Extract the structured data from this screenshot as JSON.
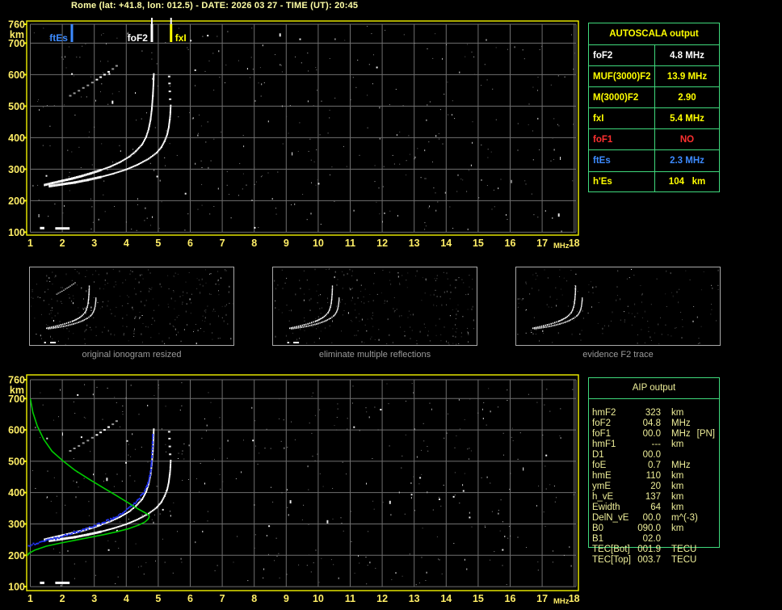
{
  "title": "Rome (lat: +41.8, lon: 012.5) - DATE: 2026 03 27 - TIME (UT): 20:45",
  "colors": {
    "background": "#000000",
    "plot_border_yellow": "#f2f200",
    "axis_label_yellow": "#ffee66",
    "grid_gray": "#6f6f6f",
    "table_green": "#3fd97c",
    "autoscala_yellow": "#ffff00",
    "autoscala_white": "#ffffff",
    "autoscala_red": "#ff3030",
    "autoscala_blue": "#3d8bff",
    "aip_text": "#eeee99",
    "profile_green": "#00cc00",
    "restored_blue": "#2233ee",
    "caption_gray": "#9b9b9b",
    "thumb_border": "#a9a9a9"
  },
  "autoscala": {
    "header": "AUTOSCALA output",
    "rows": [
      {
        "label": "foF2",
        "value": "4.8 MHz",
        "color": "#ffffff"
      },
      {
        "label": "MUF(3000)F2",
        "value": "13.9 MHz",
        "color": "#ffff00"
      },
      {
        "label": "M(3000)F2",
        "value": "2.90",
        "color": "#ffff00"
      },
      {
        "label": "fxI",
        "value": "5.4 MHz",
        "color": "#ffff00"
      },
      {
        "label": "foF1",
        "value": "NO",
        "color": "#ff3030"
      },
      {
        "label": "ftEs",
        "value": "2.3 MHz",
        "color": "#3d8bff"
      },
      {
        "label": "h'Es",
        "value": "104   km",
        "color": "#ffff00"
      }
    ]
  },
  "aip": {
    "header": "AIP output",
    "rows": [
      {
        "name": "hmF2",
        "value": "323",
        "unit": "km",
        "note": ""
      },
      {
        "name": "foF2",
        "value": "04.8",
        "unit": "MHz",
        "note": ""
      },
      {
        "name": "foF1",
        "value": "00.0",
        "unit": "MHz",
        "note": "[PN]"
      },
      {
        "name": "hmF1",
        "value": "---",
        "unit": "km",
        "note": ""
      },
      {
        "name": "D1",
        "value": "00.0",
        "unit": "",
        "note": ""
      },
      {
        "name": "foE",
        "value": "0.7",
        "unit": "MHz",
        "note": ""
      },
      {
        "name": "hmE",
        "value": "110",
        "unit": "km",
        "note": ""
      },
      {
        "name": "ymE",
        "value": "20",
        "unit": "km",
        "note": ""
      },
      {
        "name": "h_vE",
        "value": "137",
        "unit": "km",
        "note": ""
      },
      {
        "name": "Ewidth",
        "value": "64",
        "unit": "km",
        "note": ""
      },
      {
        "name": "DelN_vE",
        "value": "00.0",
        "unit": "m^(-3)",
        "note": ""
      },
      {
        "name": "B0",
        "value": "090.0",
        "unit": "km",
        "note": ""
      },
      {
        "name": "B1",
        "value": "02.0",
        "unit": "",
        "note": ""
      },
      {
        "name": "TEC[Bot]",
        "value": "001.9",
        "unit": "TECU",
        "note": ""
      },
      {
        "name": "TEC[Top]",
        "value": "003.7",
        "unit": "TECU",
        "note": ""
      }
    ]
  },
  "thumbnails": [
    {
      "caption": "original ionogram resized"
    },
    {
      "caption": "eliminate multiple reflections"
    },
    {
      "caption": "evidence F2 trace"
    }
  ],
  "chart_data": [
    {
      "type": "scatter",
      "title": "autoscaled ionogram",
      "xlabel": "MHz",
      "ylabel": "km",
      "xlim": [
        1,
        18
      ],
      "ylim": [
        100,
        760
      ],
      "x_ticks": [
        1,
        2,
        3,
        4,
        5,
        6,
        7,
        8,
        9,
        10,
        11,
        12,
        13,
        14,
        15,
        16,
        17,
        18
      ],
      "y_ticks": [
        100,
        200,
        300,
        400,
        500,
        600,
        700,
        760
      ],
      "grid": true,
      "markers": [
        {
          "label": "ftEs",
          "freq": 2.3,
          "color": "#3d8bff"
        },
        {
          "label": "foF2",
          "freq": 4.8,
          "color": "#ffffff"
        },
        {
          "label": "fxI",
          "freq": 5.4,
          "color": "#ffff00"
        }
      ],
      "series": [
        {
          "name": "o-trace",
          "color": "#ffffff",
          "style": "trace",
          "points": [
            [
              1.45,
              250
            ],
            [
              1.7,
              256
            ],
            [
              2.0,
              263
            ],
            [
              2.3,
              270
            ],
            [
              2.6,
              278
            ],
            [
              2.9,
              287
            ],
            [
              3.2,
              297
            ],
            [
              3.5,
              308
            ],
            [
              3.8,
              322
            ],
            [
              4.1,
              340
            ],
            [
              4.3,
              357
            ],
            [
              4.5,
              379
            ],
            [
              4.62,
              402
            ],
            [
              4.7,
              427
            ],
            [
              4.76,
              457
            ],
            [
              4.8,
              492
            ],
            [
              4.83,
              532
            ],
            [
              4.85,
              572
            ],
            [
              4.86,
              602
            ]
          ]
        },
        {
          "name": "x-trace",
          "color": "#ffffff",
          "style": "trace",
          "points": [
            [
              1.6,
              246
            ],
            [
              2.0,
              252
            ],
            [
              2.4,
              258
            ],
            [
              2.8,
              266
            ],
            [
              3.2,
              275
            ],
            [
              3.6,
              286
            ],
            [
              4.0,
              299
            ],
            [
              4.35,
              314
            ],
            [
              4.7,
              333
            ],
            [
              4.95,
              352
            ],
            [
              5.1,
              370
            ],
            [
              5.2,
              389
            ],
            [
              5.28,
              410
            ],
            [
              5.33,
              434
            ],
            [
              5.36,
              458
            ],
            [
              5.38,
              480
            ],
            [
              5.39,
              502
            ]
          ]
        },
        {
          "name": "x-trace-upper-dots",
          "color": "#e8e8e8",
          "style": "dots",
          "points": [
            [
              5.37,
              522
            ],
            [
              5.36,
              547
            ],
            [
              5.35,
              572
            ],
            [
              5.34,
              594
            ]
          ]
        },
        {
          "name": "second-hop-echo",
          "color": "#9a9a9a",
          "style": "dots",
          "bright": [
            6,
            7,
            8,
            9
          ],
          "points": [
            [
              2.25,
              533
            ],
            [
              2.38,
              541
            ],
            [
              2.52,
              549
            ],
            [
              2.66,
              558
            ],
            [
              2.8,
              566
            ],
            [
              2.94,
              575
            ],
            [
              3.08,
              584
            ],
            [
              3.2,
              592
            ],
            [
              3.32,
              600
            ],
            [
              3.45,
              609
            ],
            [
              3.58,
              618
            ],
            [
              3.7,
              628
            ]
          ]
        },
        {
          "name": "es-layer",
          "color": "#ffffff",
          "style": "bars",
          "points": [
            [
              1.78,
              2.23,
              112
            ],
            [
              1.3,
              1.44,
              113
            ]
          ]
        }
      ]
    },
    {
      "type": "scatter",
      "title": "ionogram with restored trace and electron density profile",
      "xlabel": "MHz",
      "ylabel": "km",
      "xlim": [
        1,
        18
      ],
      "ylim": [
        100,
        760
      ],
      "x_ticks": [
        1,
        2,
        3,
        4,
        5,
        6,
        7,
        8,
        9,
        10,
        11,
        12,
        13,
        14,
        15,
        16,
        17,
        18
      ],
      "y_ticks": [
        100,
        200,
        300,
        400,
        500,
        600,
        700,
        760
      ],
      "grid": true,
      "markers": [],
      "series": [
        {
          "name": "o-trace",
          "color": "#ffffff",
          "style": "trace",
          "points": [
            [
              1.45,
              250
            ],
            [
              1.7,
              256
            ],
            [
              2.0,
              263
            ],
            [
              2.3,
              270
            ],
            [
              2.6,
              278
            ],
            [
              2.9,
              287
            ],
            [
              3.2,
              297
            ],
            [
              3.5,
              308
            ],
            [
              3.8,
              322
            ],
            [
              4.1,
              340
            ],
            [
              4.3,
              357
            ],
            [
              4.5,
              379
            ],
            [
              4.62,
              402
            ],
            [
              4.7,
              427
            ],
            [
              4.76,
              457
            ],
            [
              4.8,
              492
            ],
            [
              4.83,
              532
            ],
            [
              4.85,
              572
            ],
            [
              4.86,
              602
            ]
          ]
        },
        {
          "name": "x-trace",
          "color": "#ffffff",
          "style": "trace",
          "points": [
            [
              1.6,
              246
            ],
            [
              2.0,
              252
            ],
            [
              2.4,
              258
            ],
            [
              2.8,
              266
            ],
            [
              3.2,
              275
            ],
            [
              3.6,
              286
            ],
            [
              4.0,
              299
            ],
            [
              4.35,
              314
            ],
            [
              4.7,
              333
            ],
            [
              4.95,
              352
            ],
            [
              5.1,
              370
            ],
            [
              5.2,
              389
            ],
            [
              5.28,
              410
            ],
            [
              5.33,
              434
            ],
            [
              5.36,
              458
            ],
            [
              5.38,
              480
            ],
            [
              5.39,
              502
            ]
          ]
        },
        {
          "name": "x-trace-upper-dots",
          "color": "#e8e8e8",
          "style": "dots",
          "points": [
            [
              5.37,
              522
            ],
            [
              5.36,
              547
            ],
            [
              5.35,
              572
            ],
            [
              5.34,
              594
            ]
          ]
        },
        {
          "name": "second-hop-echo",
          "color": "#9a9a9a",
          "style": "dots",
          "bright": [
            6,
            7,
            8,
            9
          ],
          "points": [
            [
              2.25,
              533
            ],
            [
              2.38,
              541
            ],
            [
              2.52,
              549
            ],
            [
              2.66,
              558
            ],
            [
              2.8,
              566
            ],
            [
              2.94,
              575
            ],
            [
              3.08,
              584
            ],
            [
              3.2,
              592
            ],
            [
              3.32,
              600
            ],
            [
              3.45,
              609
            ],
            [
              3.58,
              618
            ],
            [
              3.7,
              628
            ]
          ]
        },
        {
          "name": "restored-o-trace",
          "color": "#2233ee",
          "style": "jitter-trace",
          "points": [
            [
              0.95,
              231
            ],
            [
              1.2,
              238
            ],
            [
              1.5,
              246
            ],
            [
              1.8,
              254
            ],
            [
              2.1,
              263
            ],
            [
              2.4,
              272
            ],
            [
              2.7,
              282
            ],
            [
              3.0,
              293
            ],
            [
              3.3,
              305
            ],
            [
              3.6,
              319
            ],
            [
              3.9,
              336
            ],
            [
              4.15,
              354
            ],
            [
              4.35,
              374
            ],
            [
              4.52,
              396
            ],
            [
              4.65,
              421
            ],
            [
              4.73,
              450
            ],
            [
              4.78,
              482
            ],
            [
              4.8,
              514
            ],
            [
              4.82,
              550
            ],
            [
              4.83,
              587
            ]
          ]
        },
        {
          "name": "electron-density-profile",
          "color": "#00cc00",
          "style": "line",
          "points": [
            [
              1.0,
              700
            ],
            [
              1.08,
              656
            ],
            [
              1.22,
              612
            ],
            [
              1.42,
              570
            ],
            [
              1.68,
              532
            ],
            [
              2.0,
              503
            ],
            [
              2.4,
              471
            ],
            [
              2.85,
              442
            ],
            [
              3.3,
              414
            ],
            [
              3.7,
              390
            ],
            [
              4.05,
              368
            ],
            [
              4.35,
              349
            ],
            [
              4.58,
              336
            ],
            [
              4.7,
              329
            ],
            [
              4.72,
              323
            ],
            [
              4.68,
              315
            ],
            [
              4.58,
              306
            ],
            [
              4.38,
              296
            ],
            [
              4.08,
              285
            ],
            [
              3.7,
              275
            ],
            [
              3.3,
              266
            ],
            [
              2.85,
              257
            ],
            [
              2.4,
              248
            ],
            [
              1.95,
              239
            ],
            [
              1.5,
              229
            ],
            [
              1.15,
              217
            ],
            [
              0.95,
              206
            ],
            [
              0.92,
              199
            ]
          ]
        },
        {
          "name": "es-layer",
          "color": "#ffffff",
          "style": "bars",
          "points": [
            [
              1.78,
              2.23,
              112
            ],
            [
              1.3,
              1.44,
              112
            ]
          ]
        }
      ]
    }
  ]
}
